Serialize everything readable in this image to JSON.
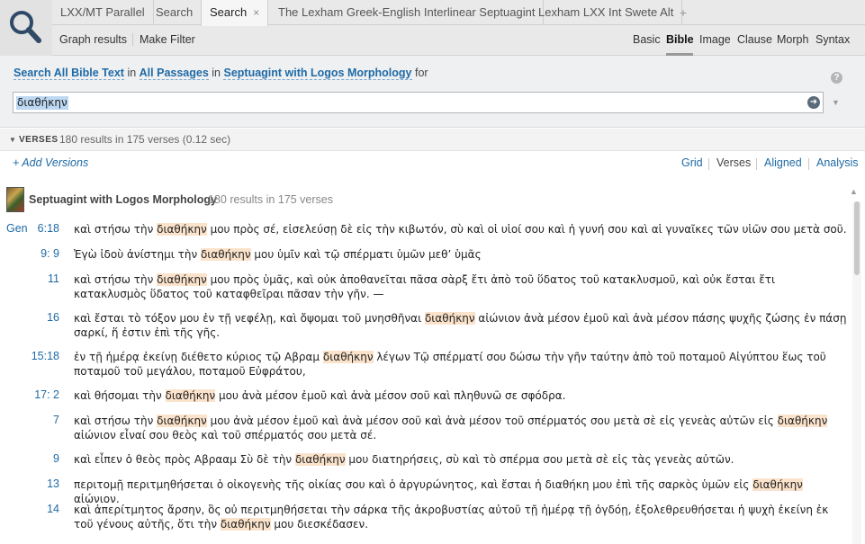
{
  "tabs": [
    {
      "label": "LXX/MT Parallel",
      "active": false
    },
    {
      "label": "Search",
      "active": false
    },
    {
      "label": "Search",
      "active": true,
      "close": "×"
    },
    {
      "label": "The Lexham Greek-English Interlinear Septuagint",
      "active": false
    },
    {
      "label": "Lexham LXX Int Swete Alt",
      "active": false
    }
  ],
  "tab_add": "+",
  "toolbar": {
    "graph_results": "Graph results",
    "make_filter": "Make Filter",
    "modes": [
      "Basic",
      "Bible",
      "Image",
      "Clause",
      "Morph",
      "Syntax"
    ],
    "active_mode": "Bible"
  },
  "search_def": {
    "part1": "Search All Bible Text",
    "in1": " in ",
    "part2": "All Passages",
    "in2": " in ",
    "part3": "Septuagint with Logos Morphology",
    "for": " for",
    "help": "?"
  },
  "query": {
    "value": "διαθήκην",
    "go_icon": "arrow-right-circle-icon"
  },
  "results_header": {
    "label": "VERSES",
    "count": "180 results in 175 verses (0.12 sec)"
  },
  "versions_row": {
    "add_versions": "+ Add Versions",
    "views": [
      "Grid",
      "Verses",
      "Aligned",
      "Analysis"
    ],
    "current_view": "Verses"
  },
  "resource": {
    "title": "Septuagint with Logos Morphology",
    "count": "180 results in 175 verses"
  },
  "verses": [
    {
      "book": "Gen",
      "ref": "6:18",
      "parts": [
        "καὶ στήσω τὴν ",
        "διαθήκην",
        " μου πρὸς σέ, εἰσελεύσῃ δὲ εἰς τὴν κιβωτόν, σὺ καὶ οἱ υἱοί σου καὶ ἡ γυνή σου καὶ αἱ γυναῖκες τῶν υἱῶν σου μετὰ σοῦ."
      ]
    },
    {
      "book": "",
      "ref": "9: 9",
      "parts": [
        "Ἐγὼ ἰδοὺ ἀνίστημι τὴν ",
        "διαθήκην",
        " μου ὑμῖν καὶ τῷ σπέρματι ὑμῶν μεθ’ ὑμᾶς"
      ]
    },
    {
      "book": "",
      "ref": "11",
      "parts": [
        "καὶ στήσω τὴν ",
        "διαθήκην",
        " μου πρὸς ὑμᾶς, καὶ οὐκ ἀποθανεῖται πᾶσα σὰρξ ἔτι ἀπὸ τοῦ ὕδατος τοῦ κατακλυσμοῦ, καὶ οὐκ ἔσται ἔτι κατακλυσμὸς ὕδατος τοῦ καταφθεῖραι πᾶσαν τὴν γῆν. —"
      ]
    },
    {
      "book": "",
      "ref": "16",
      "parts": [
        "καὶ ἔσται τὸ τόξον μου ἐν τῇ νεφέλῃ, καὶ ὄψομαι τοῦ μνησθῆναι ",
        "διαθήκην",
        " αἰώνιον ἀνὰ μέσον ἐμοῦ καὶ ἀνὰ μέσον πάσης ψυχῆς ζώσης ἐν πάσῃ σαρκί, ἥ ἐστιν ἐπὶ τῆς γῆς."
      ]
    },
    {
      "book": "",
      "ref": "15:18",
      "parts": [
        "ἐν τῇ ἡμέρᾳ ἐκείνῃ διέθετο κύριος τῷ Αβραμ ",
        "διαθήκην",
        " λέγων Τῷ σπέρματί σου δώσω τὴν γῆν ταύτην ἀπὸ τοῦ ποταμοῦ Αἰγύπτου ἕως τοῦ ποταμοῦ τοῦ μεγάλου, ποταμοῦ Εὐφράτου,"
      ]
    },
    {
      "book": "",
      "ref": "17: 2",
      "parts": [
        "καὶ θήσομαι τὴν ",
        "διαθήκην",
        " μου ἀνὰ μέσον ἐμοῦ καὶ ἀνὰ μέσον σοῦ καὶ πληθυνῶ σε σφόδρα."
      ]
    },
    {
      "book": "",
      "ref": "7",
      "parts": [
        "καὶ στήσω τὴν ",
        "διαθήκην",
        " μου ἀνὰ μέσον ἐμοῦ καὶ ἀνὰ μέσον σοῦ καὶ ἀνὰ μέσον τοῦ σπέρματός σου μετὰ σὲ εἰς γενεὰς αὐτῶν εἰς ",
        "διαθήκην",
        " αἰώνιον εἶναί σου θεὸς καὶ τοῦ σπέρματός σου μετὰ σέ."
      ]
    },
    {
      "book": "",
      "ref": "9",
      "parts": [
        "καὶ εἶπεν ὁ θεὸς πρὸς Αβρααμ Σὺ δὲ τὴν ",
        "διαθήκην",
        " μου διατηρήσεις, σὺ καὶ τὸ σπέρμα σου μετὰ σὲ εἰς τὰς γενεὰς αὐτῶν."
      ]
    },
    {
      "book": "",
      "ref": "13",
      "parts": [
        "περιτομῇ περιτμηθήσεται ὁ οἰκογενὴς τῆς οἰκίας σου καὶ ὁ ἀργυρώνητος, καὶ ἔσται ἡ διαθήκη μου ἐπὶ τῆς σαρκὸς ὑμῶν εἰς ",
        "διαθήκην",
        " αἰώνιον."
      ]
    },
    {
      "book": "",
      "ref": "14",
      "parts": [
        "καὶ ἀπερίτμητος ἄρσην, ὃς οὐ περιτμηθήσεται τὴν σάρκα τῆς ἀκροβυστίας αὐτοῦ τῇ ἡμέρᾳ τῇ ὀγδόῃ, ἐξολεθρευθήσεται ἡ ψυχὴ ἐκείνη ἐκ τοῦ γένους αὐτῆς, ὅτι τὴν ",
        "διαθήκην",
        " μου διεσκέδασεν."
      ]
    }
  ]
}
